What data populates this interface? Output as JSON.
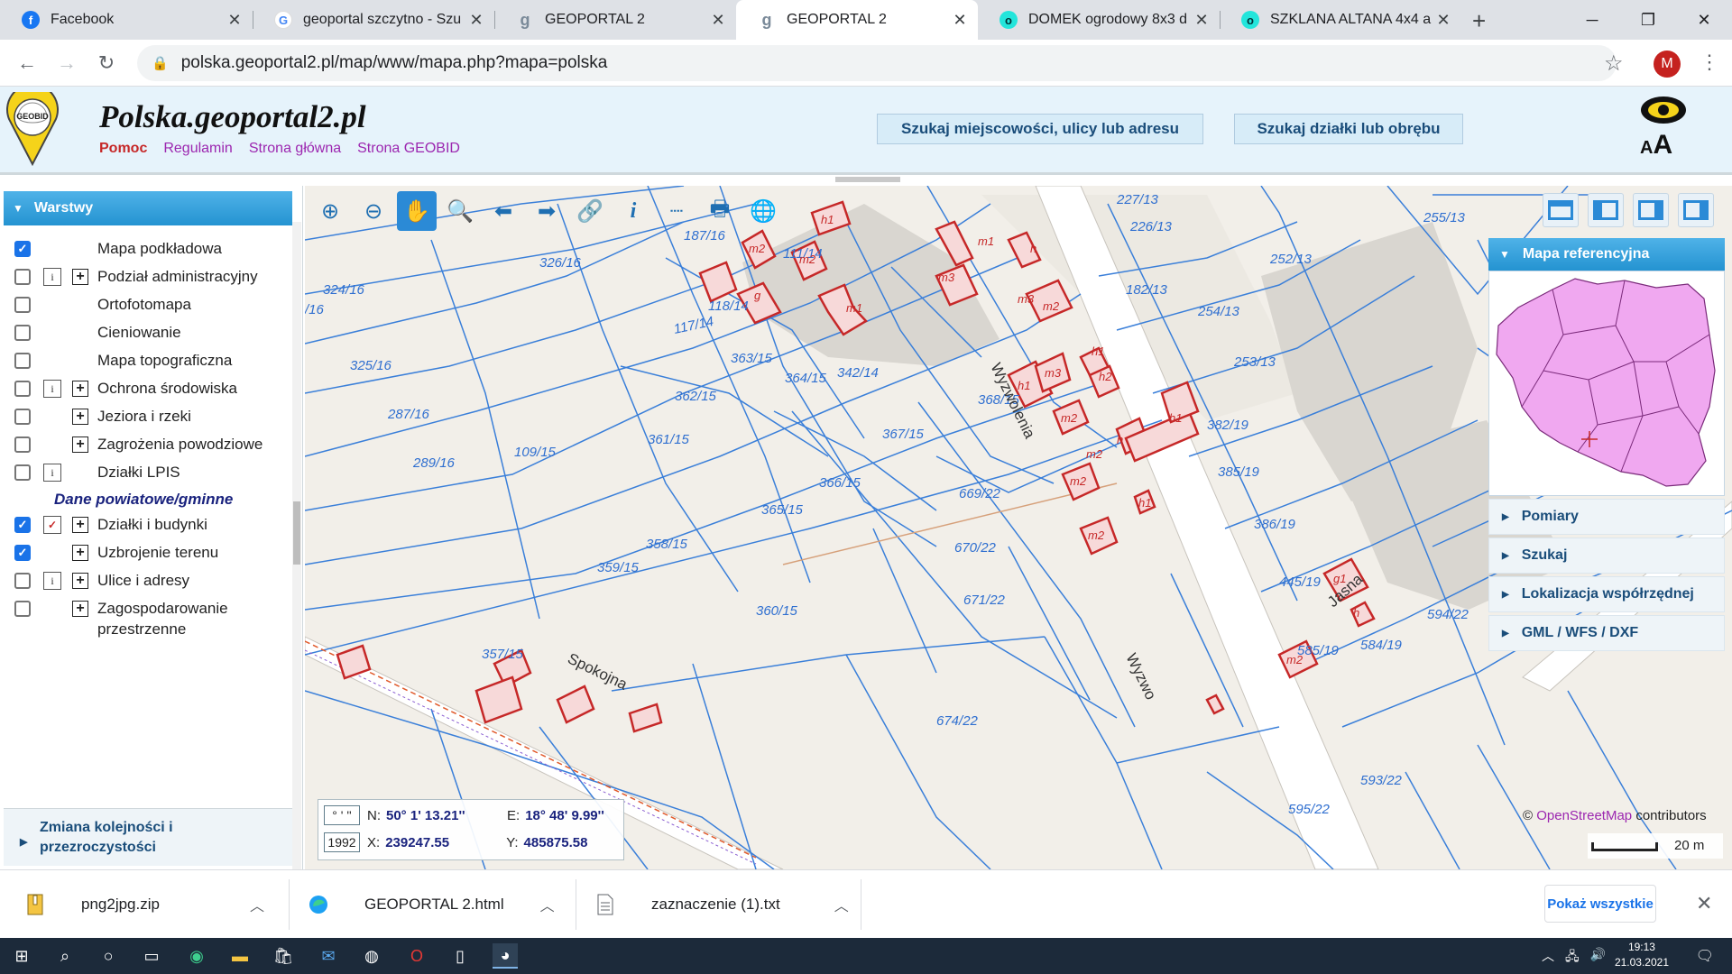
{
  "browser": {
    "tabs": [
      {
        "title": "Facebook",
        "icon": "facebook-icon",
        "color": "#1877f2",
        "glyph": "f"
      },
      {
        "title": "geoportal szczytno - Szu",
        "icon": "google-icon",
        "color": "#4285f4",
        "glyph": "G"
      },
      {
        "title": "GEOPORTAL 2",
        "icon": "geoportal-icon",
        "color": "#7a8a99",
        "glyph": "g"
      },
      {
        "title": "GEOPORTAL 2",
        "icon": "geoportal-icon",
        "color": "#7a8a99",
        "glyph": "g"
      },
      {
        "title": "DOMEK ogrodowy 8x3 d",
        "icon": "olx-icon",
        "color": "#23e5db",
        "glyph": "o"
      },
      {
        "title": "SZKLANA ALTANA 4x4 a",
        "icon": "olx-icon",
        "color": "#23e5db",
        "glyph": "o"
      }
    ],
    "new_tab": "+",
    "url": "polska.geoportal2.pl/map/www/mapa.php?mapa=polska",
    "avatar_letter": "M"
  },
  "site": {
    "title": "Polska.geoportal2.pl",
    "logo_text": "GEOBID",
    "links": [
      "Pomoc",
      "Regulamin",
      "Strona główna",
      "Strona GEOBID"
    ],
    "search_address_btn": "Szukaj miejscowości, ulicy lub adresu",
    "search_parcel_btn": "Szukaj działki lub obrębu",
    "font_size_label": "AA"
  },
  "layers_panel": {
    "header": "Warstwy",
    "section_label": "Dane powiatowe/gminne",
    "layers": [
      {
        "label": "Mapa podkładowa",
        "checked": true,
        "info": false,
        "expand": false
      },
      {
        "label": "Podział administracyjny",
        "checked": false,
        "info": true,
        "expand": true
      },
      {
        "label": "Ortofotomapa",
        "checked": false,
        "info": false,
        "expand": false
      },
      {
        "label": "Cieniowanie",
        "checked": false,
        "info": false,
        "expand": false
      },
      {
        "label": "Mapa topograficzna",
        "checked": false,
        "info": false,
        "expand": false
      },
      {
        "label": "Ochrona środowiska",
        "checked": false,
        "info": true,
        "expand": true
      },
      {
        "label": "Jeziora i rzeki",
        "checked": false,
        "info": false,
        "expand": true
      },
      {
        "label": "Zagrożenia powodziowe",
        "checked": false,
        "info": false,
        "expand": true
      },
      {
        "label": "Działki LPIS",
        "checked": false,
        "info": true,
        "expand": false
      },
      {
        "label": "Działki i budynki",
        "checked": true,
        "info": true,
        "expand": true
      },
      {
        "label": "Uzbrojenie terenu",
        "checked": true,
        "info": false,
        "expand": true
      },
      {
        "label": "Ulice i adresy",
        "checked": false,
        "info": true,
        "expand": true
      },
      {
        "label": "Zagospodarowanie",
        "label2": "przestrzenne",
        "checked": false,
        "info": false,
        "expand": true
      }
    ],
    "order_box": "Zmiana kolejności i przezroczystości"
  },
  "map": {
    "parcels": [
      "187/16",
      "111/14",
      "326/16",
      "324/16",
      "118/14",
      "117/14",
      "363/15",
      "364/15",
      "325/16",
      "362/15",
      "287/16",
      "361/15",
      "109/15",
      "289/16",
      "367/15",
      "366/15",
      "365/15",
      "669/22",
      "670/22",
      "671/22",
      "358/15",
      "359/15",
      "360/15",
      "357/15",
      "674/22",
      "227/13",
      "226/13",
      "255/13",
      "252/13",
      "182/13",
      "254/13",
      "253/13",
      "382/19",
      "385/19",
      "386/19",
      "445/19",
      "585/19",
      "584/19",
      "594/22",
      "593/22",
      "595/22",
      "368/15",
      "342/14",
      "/16"
    ],
    "buildings": [
      "h1",
      "m1",
      "m2",
      "m3",
      "m2",
      "g",
      "m1",
      "h",
      "m3",
      "m2",
      "h1",
      "m3",
      "h1",
      "h2",
      "m2",
      "h",
      "h1",
      "m2",
      "m2",
      "m2",
      "h1",
      "g1",
      "h",
      "m2"
    ],
    "streets": [
      "Wyzwolenia",
      "Spokojna",
      "Jasna",
      "Wyzwo"
    ],
    "attribution_prefix": "©",
    "attribution_link": "OpenStreetMap",
    "attribution_suffix": "contributors",
    "scale_label": "20 m"
  },
  "coords": {
    "fmt1": "° ' ''",
    "fmt2": "1992",
    "n_key": "N:",
    "n_val": "50° 1' 13.21''",
    "e_key": "E:",
    "e_val": "18° 48' 9.99''",
    "x_key": "X:",
    "x_val": "239247.55",
    "y_key": "Y:",
    "y_val": "485875.58"
  },
  "right_panel": {
    "ref_header": "Mapa referencyjna",
    "items": [
      "Pomiary",
      "Szukaj",
      "Lokalizacja współrzędnej",
      "GML / WFS / DXF"
    ]
  },
  "downloads": {
    "items": [
      {
        "name": "png2jpg.zip",
        "icon": "zip-icon"
      },
      {
        "name": "GEOPORTAL 2.html",
        "icon": "edge-icon"
      },
      {
        "name": "zaznaczenie (1).txt",
        "icon": "text-file-icon"
      }
    ],
    "show_all": "Pokaż wszystkie"
  },
  "taskbar": {
    "time": "19:13",
    "date": "21.03.2021"
  }
}
